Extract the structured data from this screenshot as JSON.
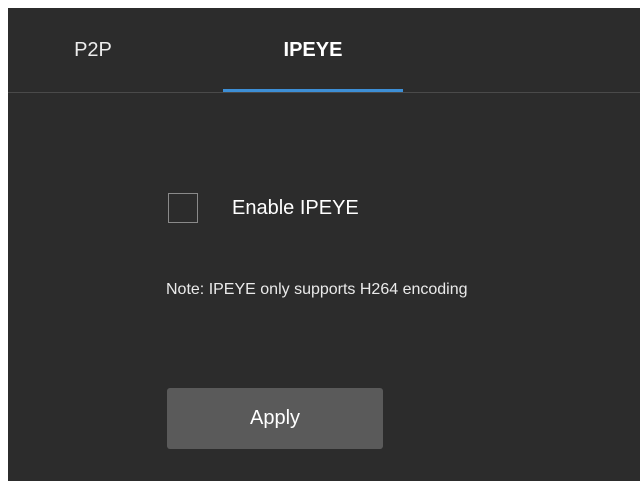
{
  "tabs": [
    {
      "label": "P2P",
      "active": false
    },
    {
      "label": "IPEYE",
      "active": true
    }
  ],
  "colors": {
    "panel_background": "#2c2c2c",
    "active_tab_underline": "#3d8fd6",
    "button_background": "#5a5a5a"
  },
  "ipeye": {
    "enable_label": "Enable IPEYE",
    "enable_checked": false,
    "note": "Note: IPEYE only supports H264 encoding",
    "apply_label": "Apply"
  }
}
